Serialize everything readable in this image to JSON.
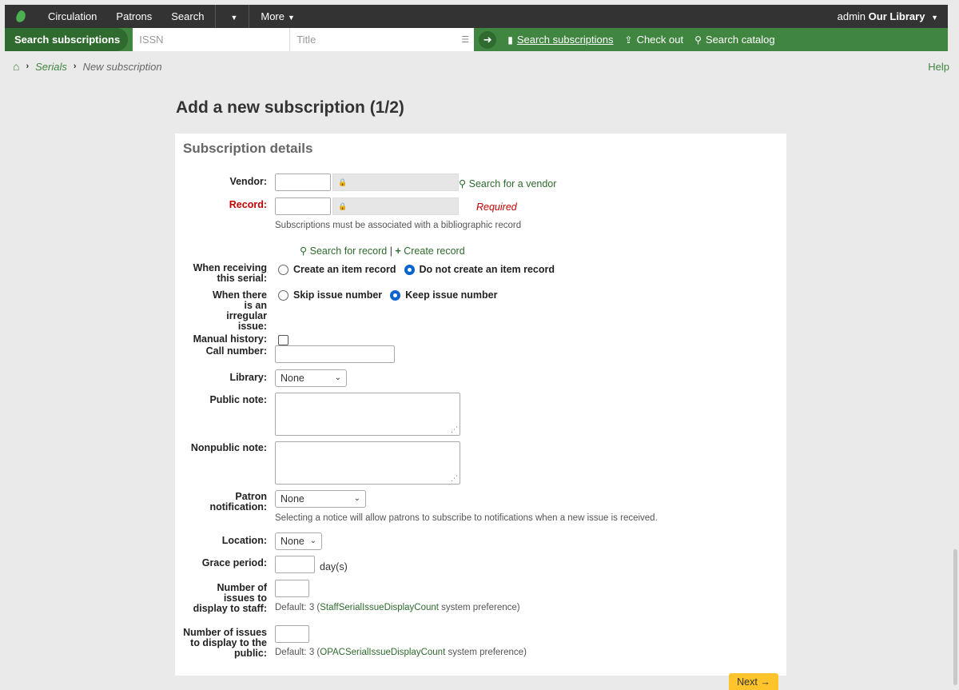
{
  "topnav": {
    "items": [
      "Circulation",
      "Patrons",
      "Search",
      "More"
    ],
    "user": "admin",
    "library": "Our Library"
  },
  "searchbar": {
    "tab_label": "Search subscriptions",
    "issn_placeholder": "ISSN",
    "title_placeholder": "Title",
    "links": [
      "Search subscriptions",
      "Check out",
      "Search catalog"
    ]
  },
  "breadcrumb": {
    "serials": "Serials",
    "current": "New subscription",
    "help": "Help"
  },
  "page_title": "Add a new subscription (1/2)",
  "panel": {
    "title": "Subscription details",
    "vendor_label": "Vendor:",
    "vendor_search_link": "Search for a vendor",
    "record_label": "Record:",
    "record_required": "Required",
    "record_hint": "Subscriptions must be associated with a bibliographic record",
    "search_record_link": "Search for record",
    "create_record_link": "Create record",
    "receiving_label": "When receiving this serial:",
    "receiving_options": [
      "Create an item record",
      "Do not create an item record"
    ],
    "irregular_label": "When there is an irregular issue:",
    "irregular_options": [
      "Skip issue number",
      "Keep issue number"
    ],
    "manual_history_label": "Manual history:",
    "call_number_label": "Call number:",
    "library_label": "Library:",
    "library_value": "None",
    "public_note_label": "Public note:",
    "nonpublic_note_label": "Nonpublic note:",
    "patron_notification_label": "Patron notification:",
    "patron_notification_value": "None",
    "patron_notification_hint": "Selecting a notice will allow patrons to subscribe to notifications when a new issue is received.",
    "location_label": "Location:",
    "location_value": "None",
    "grace_period_label": "Grace period:",
    "grace_period_unit": "day(s)",
    "staff_issues_label": "Number of issues to display to staff:",
    "staff_default_pre": "Default: 3 (",
    "staff_pref": "StaffSerialIssueDisplayCount",
    "public_issues_label": "Number of issues to display to the public:",
    "public_default_pre": "Default: 3 (",
    "public_pref": "OPACSerialIssueDisplayCount",
    "pref_suffix": " system preference)"
  },
  "next_label": "Next"
}
